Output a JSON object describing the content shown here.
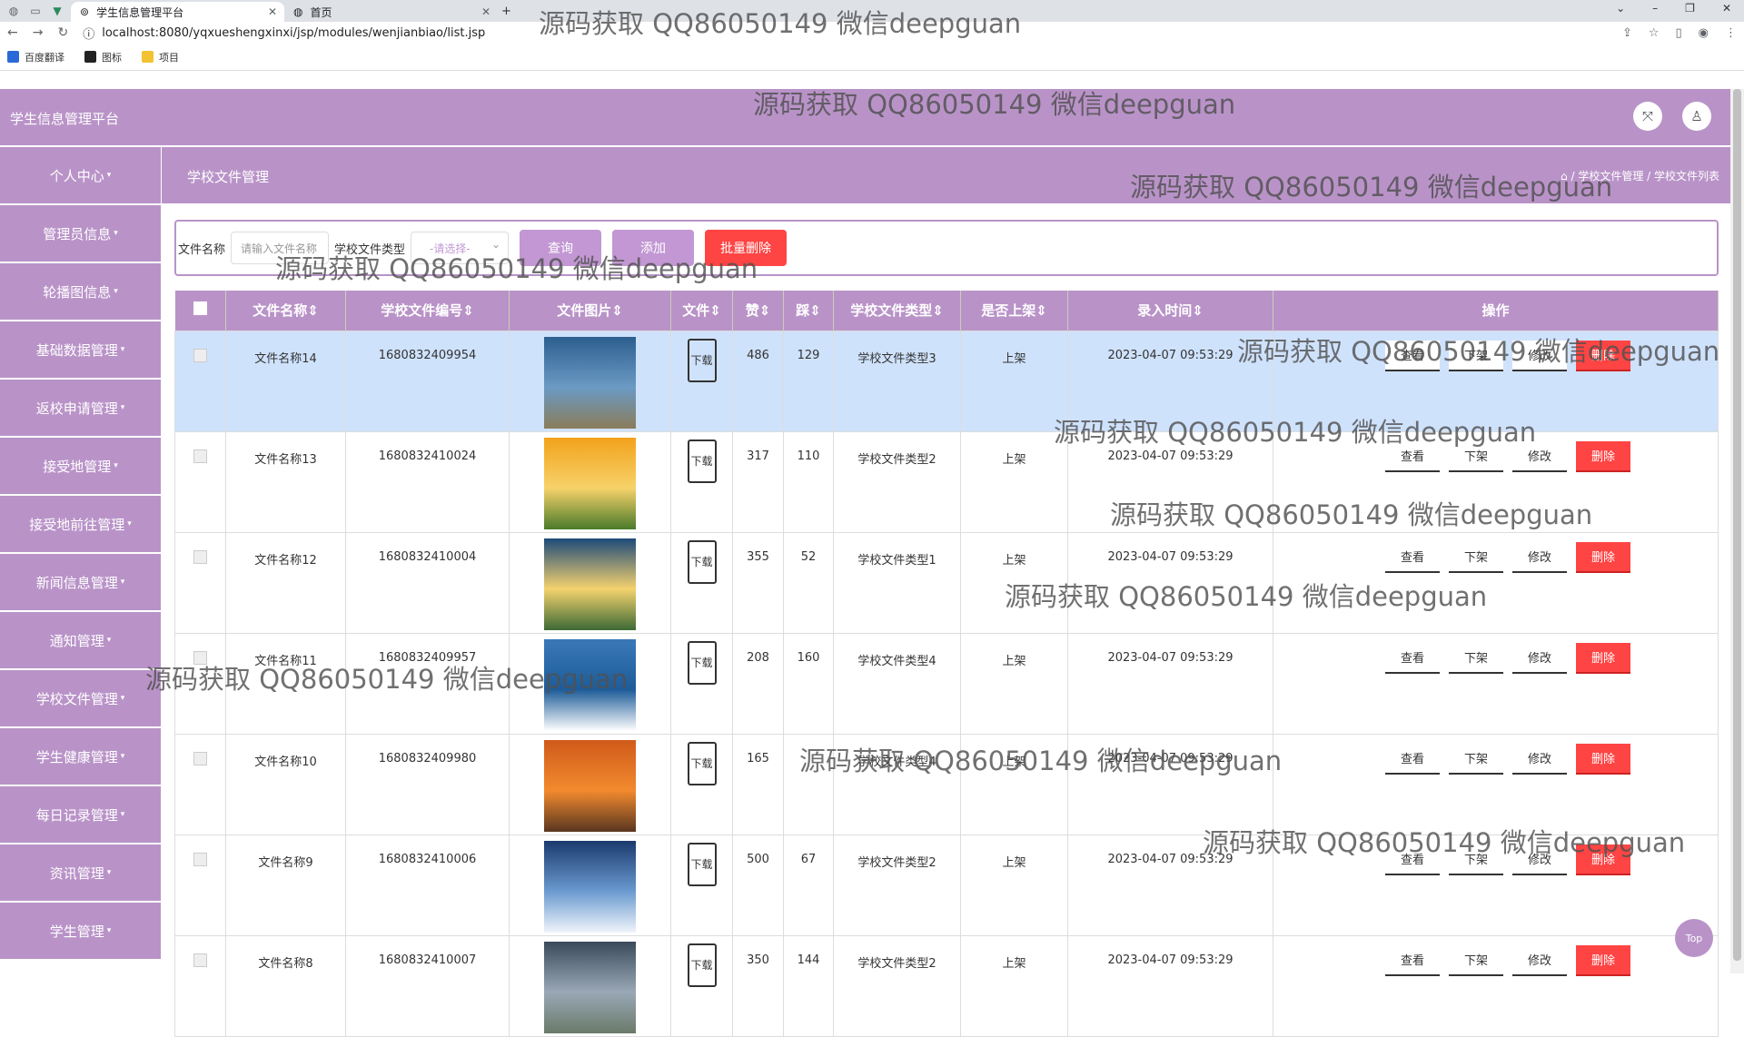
{
  "browser": {
    "tabs": [
      {
        "label": "学生信息管理平台",
        "active": true
      },
      {
        "label": "首页",
        "active": false
      }
    ],
    "url": "localhost:8080/yqxueshengxinxi/jsp/modules/wenjianbiao/list.jsp",
    "bookmarks": [
      "百度翻译",
      "图标",
      "项目"
    ]
  },
  "header": {
    "brand": "学生信息管理平台"
  },
  "sidebar": [
    "个人中心",
    "管理员信息",
    "轮播图信息",
    "基础数据管理",
    "返校申请管理",
    "接受地管理",
    "接受地前往管理",
    "新闻信息管理",
    "通知管理",
    "学校文件管理",
    "学生健康管理",
    "每日记录管理",
    "资讯管理",
    "学生管理"
  ],
  "subheader": {
    "title": "学校文件管理",
    "breadcrumb": "⌂ / 学校文件管理 / 学校文件列表"
  },
  "search": {
    "name_label": "文件名称",
    "name_placeholder": "请输入文件名称",
    "type_label": "学校文件类型",
    "type_placeholder": "-请选择-",
    "query": "查询",
    "add": "添加",
    "batch_delete": "批量删除"
  },
  "columns": [
    "文件名称⇕",
    "学校文件编号⇕",
    "文件图片⇕",
    "文件⇕",
    "赞⇕",
    "踩⇕",
    "学校文件类型⇕",
    "是否上架⇕",
    "录入时间⇕",
    "操作"
  ],
  "rows": [
    {
      "name": "文件名称14",
      "code": "1680832409954",
      "file": "下载",
      "like": "486",
      "dislike": "129",
      "type": "学校文件类型3",
      "status": "上架",
      "time": "2023-04-07 09:53:29",
      "img": [
        "#2c5e8e",
        "#6b9ac4",
        "#8a7c5a"
      ]
    },
    {
      "name": "文件名称13",
      "code": "1680832410024",
      "file": "下载",
      "like": "317",
      "dislike": "110",
      "type": "学校文件类型2",
      "status": "上架",
      "time": "2023-04-07 09:53:29",
      "img": [
        "#f2a21b",
        "#f7d26a",
        "#4a7a2a"
      ]
    },
    {
      "name": "文件名称12",
      "code": "1680832410004",
      "file": "下载",
      "like": "355",
      "dislike": "52",
      "type": "学校文件类型1",
      "status": "上架",
      "time": "2023-04-07 09:53:29",
      "img": [
        "#1e4a7a",
        "#f4d26e",
        "#3d6a35"
      ]
    },
    {
      "name": "文件名称11",
      "code": "1680832409957",
      "file": "下载",
      "like": "208",
      "dislike": "160",
      "type": "学校文件类型4",
      "status": "上架",
      "time": "2023-04-07 09:53:29",
      "img": [
        "#3a78b8",
        "#1d5c99",
        "#ffffff"
      ]
    },
    {
      "name": "文件名称10",
      "code": "1680832409980",
      "file": "下载",
      "like": "165",
      "dislike": "",
      "type": "学校文件类型4",
      "status": "上架",
      "time": "2023-04-07 09:53:29",
      "img": [
        "#d05a1a",
        "#f28a2e",
        "#5a3620"
      ]
    },
    {
      "name": "文件名称9",
      "code": "1680832410006",
      "file": "下载",
      "like": "500",
      "dislike": "67",
      "type": "学校文件类型2",
      "status": "上架",
      "time": "2023-04-07 09:53:29",
      "img": [
        "#1b3a6e",
        "#6a9ad0",
        "#f0f4fa"
      ]
    },
    {
      "name": "文件名称8",
      "code": "1680832410007",
      "file": "下载",
      "like": "350",
      "dislike": "144",
      "type": "学校文件类型2",
      "status": "上架",
      "time": "2023-04-07 09:53:29",
      "img": [
        "#3a4a5a",
        "#9aa8b6",
        "#6a7a6a"
      ]
    }
  ],
  "actions": [
    "查看",
    "下架",
    "修改",
    "删除"
  ],
  "top_button": "Top",
  "watermark": "源码获取 QQ86050149 微信deepguan",
  "colors": {
    "primary": "#b993c8",
    "danger": "#ff4444",
    "selected_row": "#cfe2fc"
  }
}
